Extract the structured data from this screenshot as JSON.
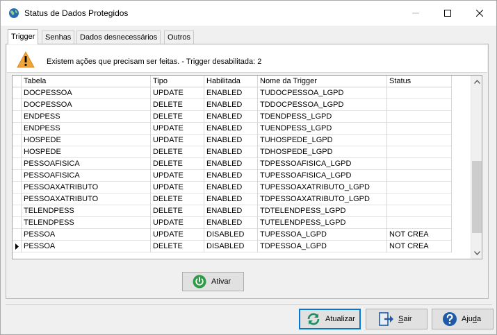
{
  "window": {
    "title": "Status de Dados Protegidos",
    "icon": "globe-icon"
  },
  "tabs": [
    {
      "label": "Trigger",
      "active": true
    },
    {
      "label": "Senhas",
      "active": false
    },
    {
      "label": "Dados desnecessários",
      "active": false
    },
    {
      "label": "Outros",
      "active": false
    }
  ],
  "warning": {
    "icon": "warning-triangle-icon",
    "text": "Existem ações que precisam ser feitas. - Trigger desabilitada: 2"
  },
  "grid": {
    "columns": [
      "Tabela",
      "Tipo",
      "Habilitada",
      "Nome da Trigger",
      "Status"
    ],
    "rows": [
      [
        "DOCPESSOA",
        "UPDATE",
        "ENABLED",
        "TUDOCPESSOA_LGPD",
        ""
      ],
      [
        "DOCPESSOA",
        "DELETE",
        "ENABLED",
        "TDDOCPESSOA_LGPD",
        ""
      ],
      [
        "ENDPESS",
        "DELETE",
        "ENABLED",
        "TDENDPESS_LGPD",
        ""
      ],
      [
        "ENDPESS",
        "UPDATE",
        "ENABLED",
        "TUENDPESS_LGPD",
        ""
      ],
      [
        "HOSPEDE",
        "UPDATE",
        "ENABLED",
        "TUHOSPEDE_LGPD",
        ""
      ],
      [
        "HOSPEDE",
        "DELETE",
        "ENABLED",
        "TDHOSPEDE_LGPD",
        ""
      ],
      [
        "PESSOAFISICA",
        "DELETE",
        "ENABLED",
        "TDPESSOAFISICA_LGPD",
        ""
      ],
      [
        "PESSOAFISICA",
        "UPDATE",
        "ENABLED",
        "TUPESSOAFISICA_LGPD",
        ""
      ],
      [
        "PESSOAXATRIBUTO",
        "UPDATE",
        "ENABLED",
        "TUPESSOAXATRIBUTO_LGPD",
        ""
      ],
      [
        "PESSOAXATRIBUTO",
        "DELETE",
        "ENABLED",
        "TDPESSOAXATRIBUTO_LGPD",
        ""
      ],
      [
        "TELENDPESS",
        "DELETE",
        "ENABLED",
        "TDTELENDPESS_LGPD",
        ""
      ],
      [
        "TELENDPESS",
        "UPDATE",
        "ENABLED",
        "TUTELENDPESS_LGPD",
        ""
      ],
      [
        "PESSOA",
        "UPDATE",
        "DISABLED",
        "TUPESSOA_LGPD",
        "NOT CREA"
      ],
      [
        "PESSOA",
        "DELETE",
        "DISABLED",
        "TDPESSOA_LGPD",
        "NOT CREA"
      ]
    ],
    "current_row": 13
  },
  "buttons": {
    "ativar": "Ativar",
    "atualizar": "Atualizar",
    "sair": "Sair",
    "ajuda": "Ajuda"
  },
  "colors": {
    "accent": "#0078d7",
    "power_icon": "#2e9b48",
    "refresh_icon": "#1f8f63",
    "help_icon": "#1e5aa8",
    "warning_icon": "#f0a43a"
  }
}
